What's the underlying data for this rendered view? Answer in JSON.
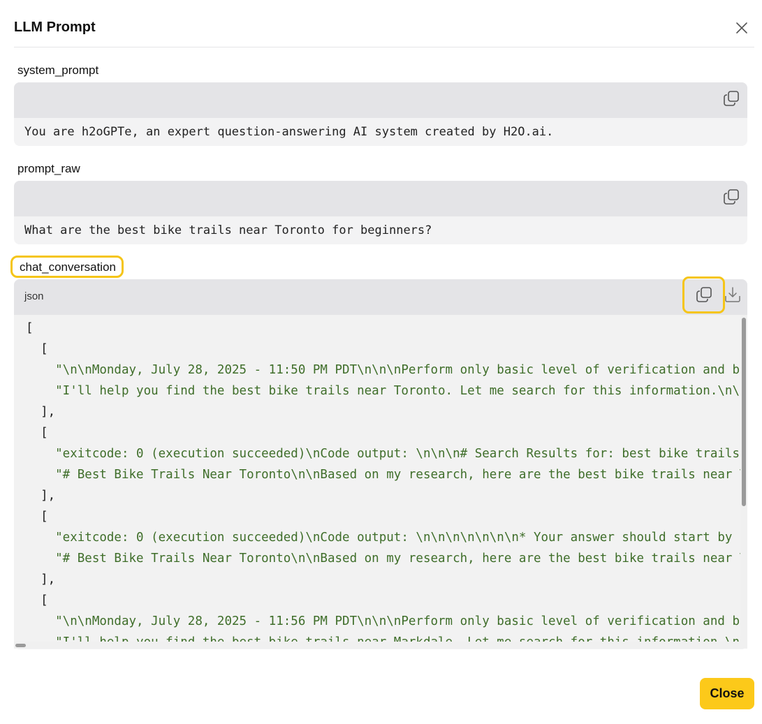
{
  "dialog": {
    "title": "LLM Prompt",
    "close_button_label": "Close"
  },
  "sections": {
    "system_prompt": {
      "label": "system_prompt",
      "text": "You are h2oGPTe, an expert question-answering AI system created by H2O.ai."
    },
    "prompt_raw": {
      "label": "prompt_raw",
      "text": "What are the best bike trails near Toronto for beginners?"
    },
    "chat_conversation": {
      "label": "chat_conversation",
      "language": "json",
      "lines": [
        "[",
        "  [",
        "    \"\\n\\nMonday, July 28, 2025 - 11:50 PM PDT\\n\\n\\nPerform only basic level of verification and ba",
        "    \"I'll help you find the best bike trails near Toronto. Let me search for this information.\\n\\n",
        "  ],",
        "  [",
        "    \"exitcode: 0 (execution succeeded)\\nCode output: \\n\\n\\n# Search Results for: best bike trails",
        "    \"# Best Bike Trails Near Toronto\\n\\nBased on my research, here are the best bike trails near T",
        "  ],",
        "  [",
        "    \"exitcode: 0 (execution succeeded)\\nCode output: \\n\\n\\n\\n\\n\\n\\n* Your answer should start by a",
        "    \"# Best Bike Trails Near Toronto\\n\\nBased on my research, here are the best bike trails near T",
        "  ],",
        "  [",
        "    \"\\n\\nMonday, July 28, 2025 - 11:56 PM PDT\\n\\n\\nPerform only basic level of verification and ba",
        "    \"I'll help you find the best bike trails near Markdale. Let me search for this information.\\n\\n"
      ]
    }
  },
  "icons": {
    "close": "close-icon",
    "copy": "copy-icon",
    "download": "download-icon"
  },
  "colors": {
    "accent": "#fcc91a",
    "highlight_border": "#f5c518",
    "json_string": "#3f6e2a",
    "code_bar": "#e4e4e7",
    "code_bg": "#f3f3f4"
  }
}
